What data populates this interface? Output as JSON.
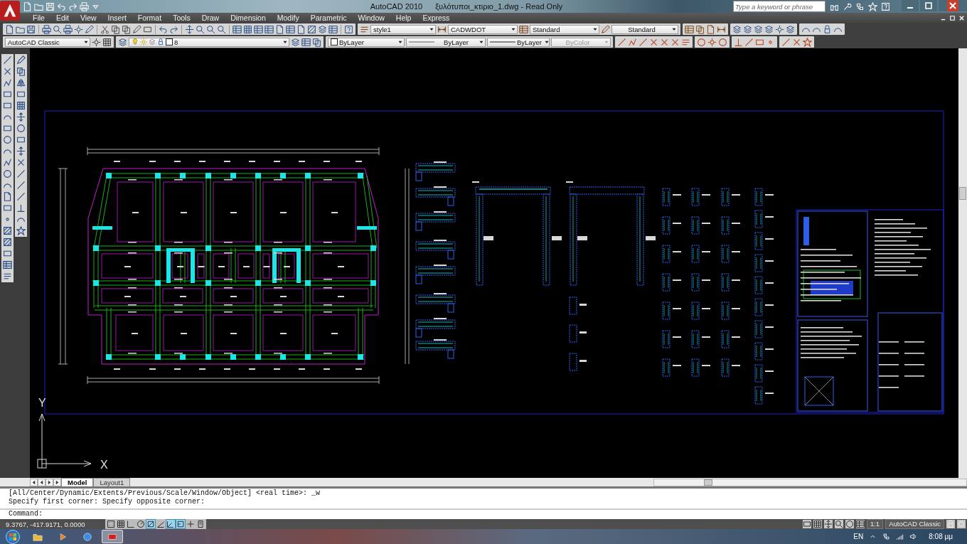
{
  "window": {
    "app_name": "AutoCAD 2010",
    "document": "ξυλότυποι_κτιριο_1.dwg - Read Only"
  },
  "search": {
    "placeholder": "Type a keyword or phrase"
  },
  "menu": [
    "File",
    "Edit",
    "View",
    "Insert",
    "Format",
    "Tools",
    "Draw",
    "Dimension",
    "Modify",
    "Parametric",
    "Window",
    "Help",
    "Express"
  ],
  "style_dropdowns": [
    {
      "kind": "text",
      "value": "style1"
    },
    {
      "kind": "dimension",
      "value": "CADWDOT"
    },
    {
      "kind": "table",
      "value": "Standard"
    },
    {
      "kind": "multileader",
      "value": "Standard"
    }
  ],
  "workspace": {
    "value": "AutoCAD Classic"
  },
  "layer": {
    "value": "8"
  },
  "properties": [
    {
      "kind": "color",
      "value": "ByLayer",
      "disabled": false
    },
    {
      "kind": "linetype",
      "value": "ByLayer",
      "disabled": false
    },
    {
      "kind": "lineweight",
      "value": "ByLayer",
      "disabled": false
    },
    {
      "kind": "plotstyle",
      "value": "ByColor",
      "disabled": true
    }
  ],
  "ucs": {
    "y_label": "Y",
    "x_label": "X"
  },
  "layout_tabs": [
    {
      "label": "Model",
      "selected": true
    },
    {
      "label": "Layout1",
      "selected": false
    }
  ],
  "command": {
    "history": [
      "[All/Center/Dynamic/Extents/Previous/Scale/Window/Object] <real time>: _w",
      "Specify first corner: Specify opposite corner:"
    ],
    "prompt": "Command:"
  },
  "status": {
    "coordinates": "9.3767, -417.9171, 0.0000",
    "toggles": [
      {
        "kind": "snap",
        "on": false
      },
      {
        "kind": "grid",
        "on": false
      },
      {
        "kind": "ortho",
        "on": false
      },
      {
        "kind": "polar",
        "on": false
      },
      {
        "kind": "osnap",
        "on": true
      },
      {
        "kind": "otrack",
        "on": false
      },
      {
        "kind": "ducs",
        "on": true
      },
      {
        "kind": "dyn",
        "on": true
      },
      {
        "kind": "lwt",
        "on": false
      },
      {
        "kind": "qp",
        "on": false
      }
    ],
    "annotation_scale": "1:1",
    "workspace": "AutoCAD Classic"
  },
  "taskbar": {
    "apps": [
      {
        "kind": "explorer",
        "selected": false
      },
      {
        "kind": "media",
        "selected": false
      },
      {
        "kind": "browser",
        "selected": false
      },
      {
        "kind": "cad",
        "selected": true
      }
    ],
    "language": "EN",
    "clock": "8:08 μμ"
  }
}
